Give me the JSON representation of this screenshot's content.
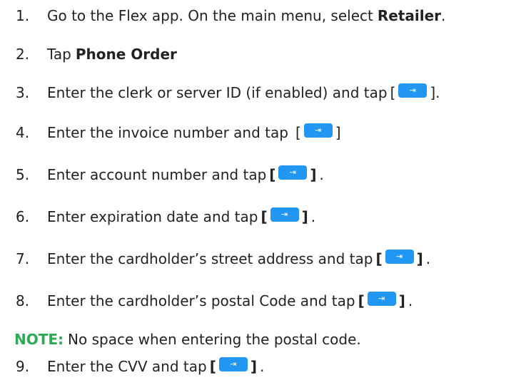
{
  "steps": [
    {
      "num": "1.",
      "text": "Go to the Flex app. On the main menu, select ",
      "bold": "Retailer",
      "after": "."
    },
    {
      "num": "2.",
      "text": "Tap ",
      "bold": "Phone Order"
    },
    {
      "num": "3.",
      "text": "Enter the clerk or server ID (if enabled) and tap",
      "bracket_open": "[",
      "bracket_close": "].",
      "bold_brackets": false
    },
    {
      "num": "4.",
      "text": "Enter the invoice number and tap",
      "bracket_open": "[",
      "bracket_close": "]",
      "bold_brackets": false
    },
    {
      "num": "5.",
      "text": "Enter account number and tap",
      "bracket_open": "[",
      "bracket_close": "]",
      "after": ".",
      "bold_brackets": true
    },
    {
      "num": "6.",
      "text": "Enter expiration date and tap",
      "bracket_open": "[",
      "bracket_close": "]",
      "after": ".",
      "bold_brackets": true
    },
    {
      "num": "7.",
      "text": "Enter the cardholder’s street address and tap",
      "bracket_open": "[",
      "bracket_close": "]",
      "after": ".",
      "bold_brackets": true
    },
    {
      "num": "8.",
      "text": "Enter the cardholder’s postal Code and tap",
      "bracket_open": "[",
      "bracket_close": "]",
      "after": ".",
      "bold_brackets": true
    },
    {
      "num": "9.",
      "text": "Enter the CVV and tap",
      "bracket_open": "[",
      "bracket_close": "]",
      "after": ".",
      "bold_brackets": true
    }
  ],
  "note": {
    "label": "NOTE:",
    "text": "No space when entering the postal code."
  },
  "enter_key": {
    "glyph": "⇥",
    "icon": "tab-enter-icon",
    "color": "#2196f3"
  },
  "colors": {
    "text": "#222222",
    "note": "#2eaa55"
  }
}
